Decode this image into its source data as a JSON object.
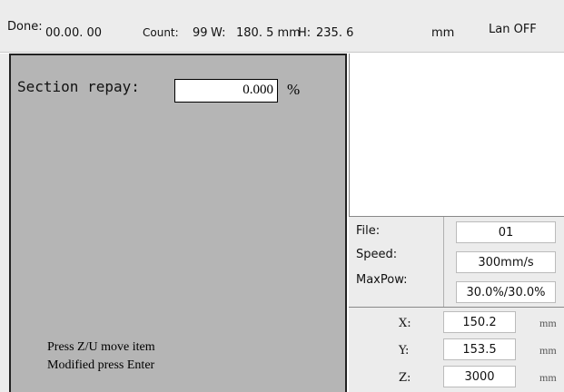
{
  "status_bar": {
    "done_label": "Done:",
    "done_value": "00.00. 00",
    "count_label": "Count:",
    "count_value": "99",
    "w_label": "W:",
    "w_value": "180. 5 mm",
    "h_label": "H:",
    "h_value": "235. 6",
    "unit": "mm",
    "lan_status": "Lan OFF"
  },
  "menu": {
    "section_repay_label": "Section repay:",
    "section_repay_value": "0.000",
    "section_repay_unit": "%",
    "hint_line1": "Press Z/U move item",
    "hint_line2": "Modified press Enter"
  },
  "info": {
    "file_label": "File:",
    "file_value": "01",
    "speed_label": "Speed:",
    "speed_value": "300mm/s",
    "maxpow_label": "MaxPow:",
    "maxpow_value": "30.0%/30.0%"
  },
  "coords": {
    "x_label": "X:",
    "x_value": "150.2",
    "y_label": "Y:",
    "y_value": "153.5",
    "z_label": "Z:",
    "z_value": "3000",
    "unit": "mm"
  }
}
